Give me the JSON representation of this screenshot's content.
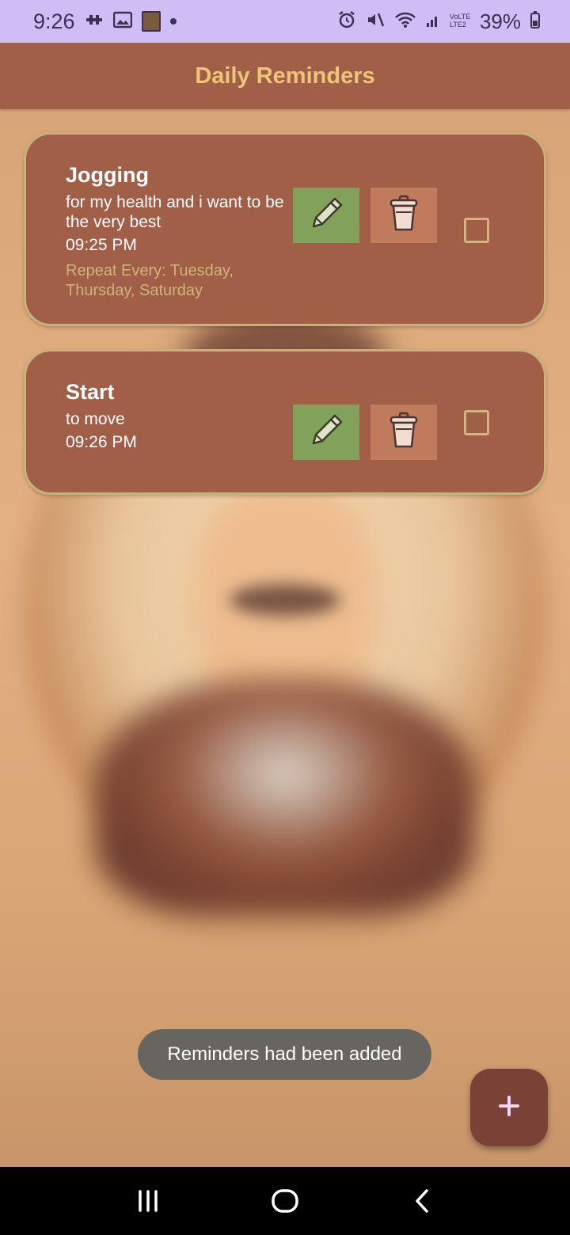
{
  "status_bar": {
    "time": "9:26",
    "battery": "39%",
    "icons": [
      "puzzle-icon",
      "gallery-icon",
      "avatar-icon",
      "dot-icon",
      "alarm-icon",
      "mute-icon",
      "wifi-icon",
      "signal-icon",
      "volte-icon",
      "battery-icon"
    ]
  },
  "app_bar": {
    "title": "Daily Reminders"
  },
  "reminders": [
    {
      "title": "Jogging",
      "description": "for my health and i want to be the very best",
      "time": "09:25 PM",
      "repeat": "Repeat Every: Tuesday, Thursday, Saturday"
    },
    {
      "title": "Start",
      "description": "to move",
      "time": "09:26 PM",
      "repeat": ""
    }
  ],
  "toast": {
    "message": "Reminders had been added"
  },
  "fab": {
    "icon": "plus-icon"
  },
  "colors": {
    "app_bar": "#a15f48",
    "title": "#f0c27a",
    "card_border": "#c8b27c",
    "edit_button": "#82a25c",
    "delete_button": "#bf7b5c",
    "fab": "#7a4236",
    "status_bar": "#cfbdf5"
  }
}
